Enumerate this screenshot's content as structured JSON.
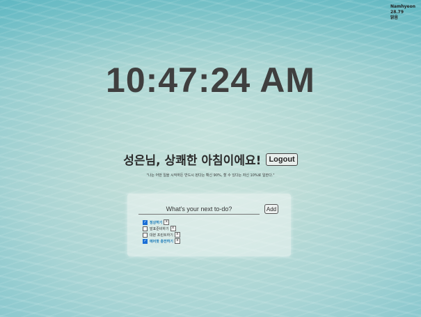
{
  "weather": {
    "name": "Namhyeon",
    "temperature": "28.79",
    "condition": "맑음"
  },
  "clock": {
    "time": "10:47:24 AM"
  },
  "greeting": {
    "text": "성은님, 상쾌한 아침이에요!",
    "logout_label": "Logout"
  },
  "quote": {
    "text": "\"나는 어떤 일을 시작하든 반드시 된다는 확신 90%, 할 수 있다는 자신 10%로 일한다.\""
  },
  "todo": {
    "placeholder": "What's your next to-do?",
    "add_label": "Add",
    "delete_label": "x",
    "items": [
      {
        "text": "정상하기",
        "checked": true
      },
      {
        "text": "발표준비하기",
        "checked": false
      },
      {
        "text": "대본 프린트하기",
        "checked": false
      },
      {
        "text": "에어팟 충전하기",
        "checked": true
      }
    ]
  },
  "colors": {
    "accent_blue": "#1a6fd6",
    "done_text": "#1a7bb8",
    "clock_text": "#3f3f3f"
  }
}
